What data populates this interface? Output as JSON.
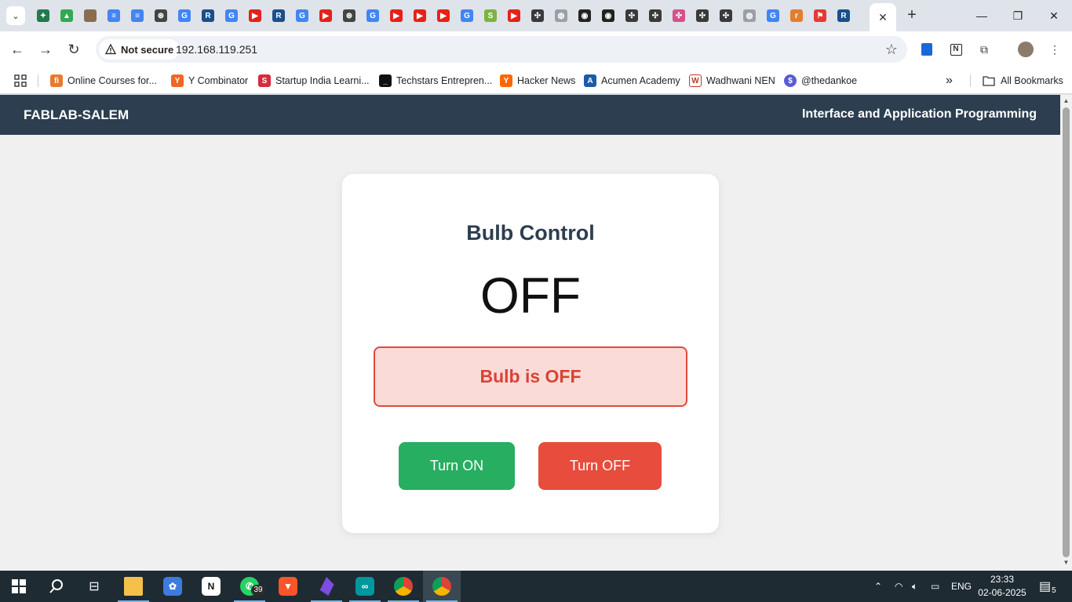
{
  "browser": {
    "tab_favicons": [
      "perplexity",
      "drive",
      "photo",
      "docs",
      "docs",
      "openai",
      "google",
      "r",
      "google",
      "youtube",
      "r",
      "google",
      "youtube",
      "openai",
      "google",
      "youtube",
      "youtube",
      "youtube",
      "google",
      "s-app",
      "youtube",
      "fablab",
      "globe",
      "notion-dark",
      "notion-dark",
      "fablab",
      "fablab",
      "fablab-pink",
      "fablab",
      "fablab",
      "globe",
      "google",
      "r-orange",
      "bookmark-red",
      "r"
    ],
    "active_tab_close": "✕",
    "new_tab": "+",
    "security_label": "Not secure",
    "url": "192.168.119.251",
    "bookmarks": [
      {
        "label": "Online Courses for...",
        "icon": "fi",
        "color": "#e87a2e"
      },
      {
        "label": "Y Combinator",
        "icon": "Y",
        "color": "#f26522"
      },
      {
        "label": "Startup India Learni...",
        "icon": "S",
        "color": "#d62b3b"
      },
      {
        "label": "Techstars Entrepren...",
        "icon": "_",
        "color": "#111111"
      },
      {
        "label": "Hacker News",
        "icon": "Y",
        "color": "#ff6600"
      },
      {
        "label": "Acumen Academy",
        "icon": "A",
        "color": "#1e5aa8"
      },
      {
        "label": "Wadhwani NEN",
        "icon": "W",
        "color": "#c0392b"
      },
      {
        "label": "@thedankoe",
        "icon": "$",
        "color": "#5b5bd6"
      }
    ],
    "bookmarks_overflow": "»",
    "all_bookmarks": "All Bookmarks"
  },
  "site": {
    "brand": "FABLAB-SALEM",
    "subtitle": "Interface and Application Programming"
  },
  "card": {
    "title": "Bulb Control",
    "state": "OFF",
    "status_prefix": "Bulb is ",
    "status_value": "OFF",
    "turn_on_label": "Turn ON",
    "turn_off_label": "Turn OFF"
  },
  "colors": {
    "header_bg": "#2c3e50",
    "on_button": "#27ae60",
    "off_button": "#e74c3c",
    "status_bg": "#fadbd8",
    "status_text": "#d94335"
  },
  "taskbar": {
    "apps": [
      "start-icon",
      "search-icon",
      "task-view-icon",
      "file-explorer-icon",
      "paint-icon",
      "notion-icon",
      "whatsapp-icon",
      "brave-icon",
      "obsidian-icon",
      "arduino-icon",
      "chrome-icon",
      "chrome-active-icon"
    ],
    "whatsapp_badge": "39",
    "language": "ENG",
    "time": "23:33",
    "date": "02-06-2025",
    "notifications": "5"
  }
}
